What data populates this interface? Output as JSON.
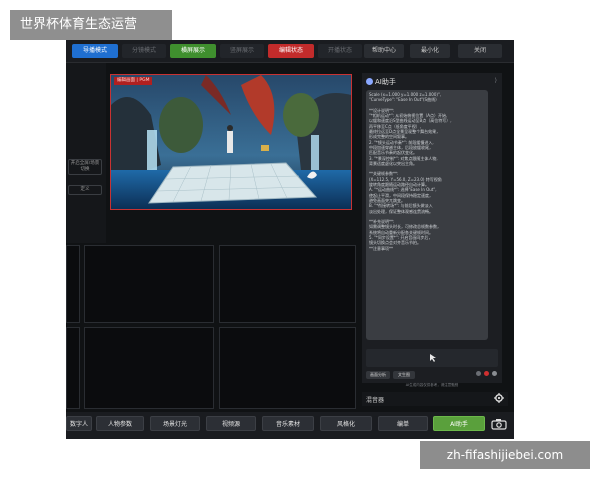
{
  "watermark_top": "世界杯体育生态运营",
  "watermark_bottom": "zh-fifashijiebei.com",
  "toolbar": {
    "buttons": [
      {
        "label": "导播模式",
        "color": "#1f6fd1"
      },
      {
        "label": "分镜模式",
        "color": "#22252a"
      },
      {
        "label": "横屏展示",
        "color": "#3f8f2e"
      },
      {
        "label": "竖屏展示",
        "color": "#22252a"
      },
      {
        "label": "编辑状态",
        "color": "#c22b2b"
      },
      {
        "label": "开播状态",
        "color": "#22252a"
      },
      {
        "label": "帮助中心",
        "color": "#2a2d32"
      },
      {
        "label": "最小化",
        "color": "#2a2d32"
      },
      {
        "label": "关闭",
        "color": "#2a2d32"
      }
    ]
  },
  "left_panel": {
    "btn1": "开启全屏/场景切换",
    "select1": "定义"
  },
  "preview": {
    "label": "编辑画面 | PGM"
  },
  "ai_panel": {
    "title": "AI助手",
    "messages": [
      "Scale (x=1.000 y=1.000 z=1.000)\",",
      "\"CurveType\": \"Ease In Out\"(S曲线)",
      "",
      "**设计说明**:",
      "  \"*相机运动*\": 从初始俯视位置（A点）开始,",
      "以缓和速度沿S型曲线运动至B点（高位特写）,",
      "再平移至C点（低角度平视）,",
      "最终拉远至D点全景呈现整个舞台效果，",
      "形成完整的空间叙事。",
      "2. \"*镜头运动节奏*\": 前段缓慢进入,",
      "中段加速穿越主体，后段放缓收尾，",
      "匹配音乐节奏的起伏变化。",
      "3. \"*景深控制*\": 对焦点跟随主体人物,",
      "背景适度虚化以突出主角。",
      "",
      "**关键帧参数**:",
      "(X=112.5, Y=56.0, Z=23.0) 特写视角",
      "旋转角度跟随运动路径自动计算。",
      "  A. \"*运动曲线*\": 选择\"Ease In Out\",",
      "使起止平滑，中间段保持稳定速度，",
      "避免画面突兀跳变。",
      "  B. \"*衔接转场*\": 与前后镜头做淡入",
      "淡出处理，保证整体观感连贯流畅。",
      "",
      "**补充说明**:",
      "如需调整镜头时长，可修改总帧数参数，",
      "系统将自动重新分配各关键帧时间。",
      "5. \"*同步设置*\": 开启音画同步后，",
      "镜头切换点会对齐音乐节拍。",
      "**注意事项**"
    ],
    "chip1": "画面分析",
    "chip2": "文生图",
    "tip": "AI生成内容仅供参考，请注意甄别"
  },
  "mixer": {
    "label": "混音器"
  },
  "bottom": {
    "buttons": [
      {
        "label": "数字人",
        "active": false
      },
      {
        "label": "人物参数",
        "active": false
      },
      {
        "label": "场景灯光",
        "active": false
      },
      {
        "label": "视频源",
        "active": false
      },
      {
        "label": "音乐素材",
        "active": false
      },
      {
        "label": "风格化",
        "active": false
      },
      {
        "label": "编单",
        "active": false
      },
      {
        "label": "AI助手",
        "active": true
      }
    ]
  },
  "colors": {
    "accent_red": "#c83232",
    "accent_green": "#5aa03c",
    "accent_blue": "#1f6fd1"
  }
}
